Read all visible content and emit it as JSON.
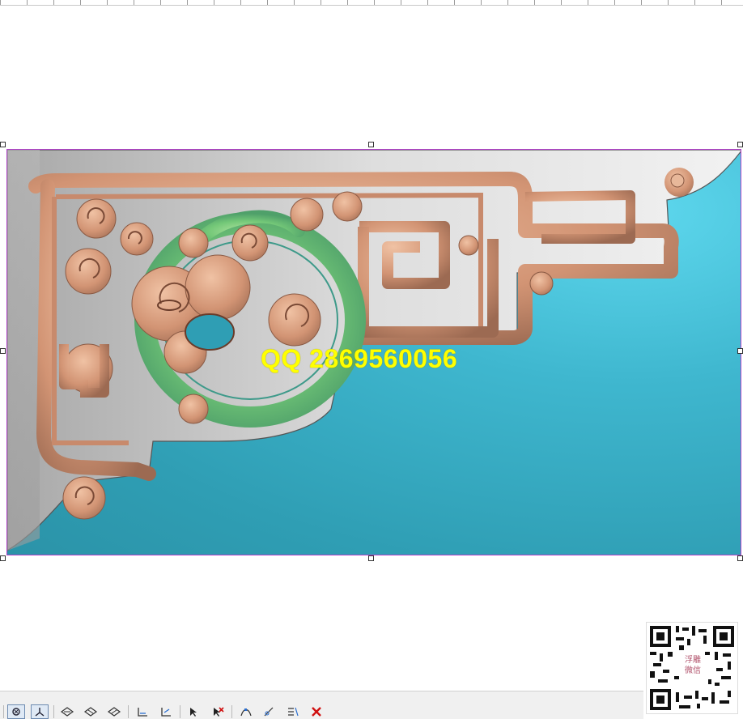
{
  "watermark": {
    "text": "QQ 2869560056",
    "color": "#ffff00"
  },
  "qr": {
    "line1": "浮雕",
    "line2": "微信"
  },
  "colors": {
    "background_relief": "#3fb7cf",
    "ornament": "#d49a7a",
    "green_accent": "#7ccf7a",
    "border_gray": "#b8b8b8",
    "selection_border": "#b040c8"
  },
  "toolbar": {
    "buttons": [
      {
        "name": "view-mode-1-icon"
      },
      {
        "name": "view-mode-2-icon"
      },
      {
        "name": "shade-1-icon"
      },
      {
        "name": "shade-2-icon"
      },
      {
        "name": "shade-3-icon"
      },
      {
        "name": "align-base-icon"
      },
      {
        "name": "align-base-2-icon"
      },
      {
        "name": "select-arrow-icon"
      },
      {
        "name": "delete-select-icon"
      },
      {
        "name": "node-edit-icon"
      },
      {
        "name": "curve-edit-icon"
      },
      {
        "name": "layer-edit-icon"
      },
      {
        "name": "close-icon"
      }
    ]
  }
}
